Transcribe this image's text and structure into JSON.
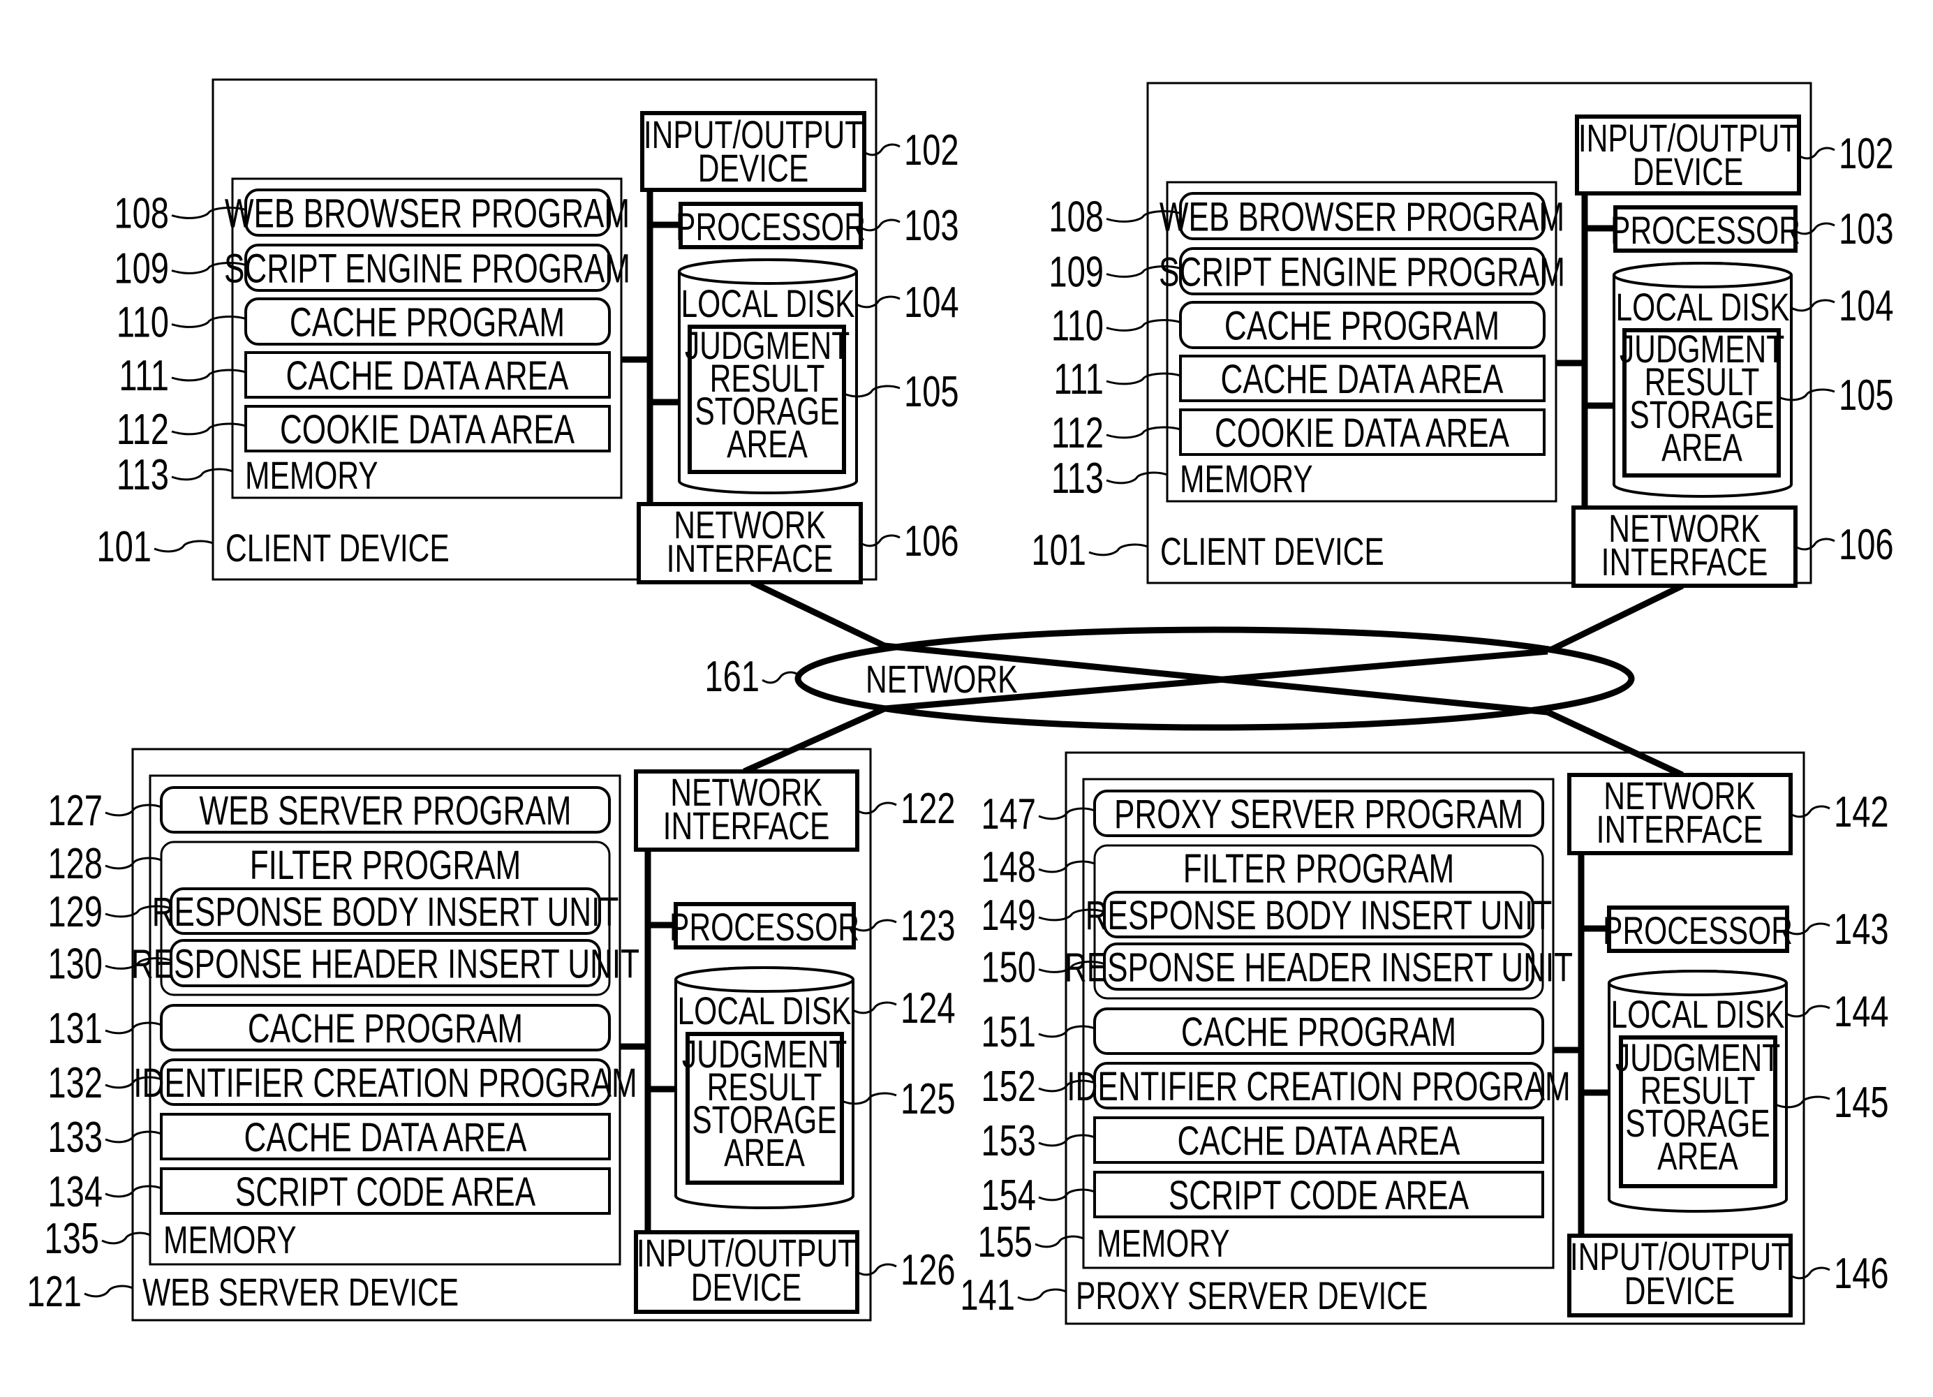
{
  "figure": {
    "network": {
      "ref": "161",
      "label": "NETWORK"
    },
    "client_devices": [
      {
        "ref": "101",
        "label": "CLIENT DEVICE",
        "memory": {
          "ref": "113",
          "label": "MEMORY",
          "items": [
            {
              "ref": "108",
              "label": "WEB BROWSER PROGRAM",
              "shape": "rounded"
            },
            {
              "ref": "109",
              "label": "SCRIPT ENGINE PROGRAM",
              "shape": "rounded"
            },
            {
              "ref": "110",
              "label": "CACHE PROGRAM",
              "shape": "rounded"
            },
            {
              "ref": "111",
              "label": "CACHE DATA AREA",
              "shape": "square"
            },
            {
              "ref": "112",
              "label": "COOKIE DATA AREA",
              "shape": "square"
            }
          ]
        },
        "io_device": {
          "ref": "102",
          "lines": [
            "INPUT/OUTPUT",
            "DEVICE"
          ]
        },
        "processor": {
          "ref": "103",
          "label": "PROCESSOR"
        },
        "local_disk": {
          "ref": "104",
          "label": "LOCAL DISK",
          "storage": {
            "ref": "105",
            "lines": [
              "JUDGMENT",
              "RESULT",
              "STORAGE",
              "AREA"
            ]
          }
        },
        "network_interface": {
          "ref": "106",
          "lines": [
            "NETWORK",
            "INTERFACE"
          ]
        }
      },
      {
        "ref": "101",
        "label": "CLIENT DEVICE",
        "memory": {
          "ref": "113",
          "label": "MEMORY",
          "items": [
            {
              "ref": "108",
              "label": "WEB BROWSER PROGRAM",
              "shape": "rounded"
            },
            {
              "ref": "109",
              "label": "SCRIPT ENGINE PROGRAM",
              "shape": "rounded"
            },
            {
              "ref": "110",
              "label": "CACHE PROGRAM",
              "shape": "rounded"
            },
            {
              "ref": "111",
              "label": "CACHE DATA AREA",
              "shape": "square"
            },
            {
              "ref": "112",
              "label": "COOKIE DATA AREA",
              "shape": "square"
            }
          ]
        },
        "io_device": {
          "ref": "102",
          "lines": [
            "INPUT/OUTPUT",
            "DEVICE"
          ]
        },
        "processor": {
          "ref": "103",
          "label": "PROCESSOR"
        },
        "local_disk": {
          "ref": "104",
          "label": "LOCAL DISK",
          "storage": {
            "ref": "105",
            "lines": [
              "JUDGMENT",
              "RESULT",
              "STORAGE",
              "AREA"
            ]
          }
        },
        "network_interface": {
          "ref": "106",
          "lines": [
            "NETWORK",
            "INTERFACE"
          ]
        }
      }
    ],
    "server_devices": [
      {
        "ref": "121",
        "label": "WEB SERVER DEVICE",
        "memory": {
          "ref": "135",
          "label": "MEMORY",
          "main_program": {
            "ref": "127",
            "label": "WEB SERVER PROGRAM"
          },
          "filter": {
            "ref": "128",
            "label": "FILTER PROGRAM",
            "units": [
              {
                "ref": "129",
                "label": "RESPONSE BODY INSERT UNIT"
              },
              {
                "ref": "130",
                "label": "RESPONSE HEADER INSERT UNIT"
              }
            ]
          },
          "items": [
            {
              "ref": "131",
              "label": "CACHE PROGRAM",
              "shape": "rounded"
            },
            {
              "ref": "132",
              "label": "IDENTIFIER CREATION PROGRAM",
              "shape": "rounded"
            },
            {
              "ref": "133",
              "label": "CACHE DATA AREA",
              "shape": "square"
            },
            {
              "ref": "134",
              "label": "SCRIPT CODE AREA",
              "shape": "square"
            }
          ]
        },
        "network_interface": {
          "ref": "122",
          "lines": [
            "NETWORK",
            "INTERFACE"
          ]
        },
        "processor": {
          "ref": "123",
          "label": "PROCESSOR"
        },
        "local_disk": {
          "ref": "124",
          "label": "LOCAL DISK",
          "storage": {
            "ref": "125",
            "lines": [
              "JUDGMENT",
              "RESULT",
              "STORAGE",
              "AREA"
            ]
          }
        },
        "io_device": {
          "ref": "126",
          "lines": [
            "INPUT/OUTPUT",
            "DEVICE"
          ]
        }
      },
      {
        "ref": "141",
        "label": "PROXY SERVER DEVICE",
        "memory": {
          "ref": "155",
          "label": "MEMORY",
          "main_program": {
            "ref": "147",
            "label": "PROXY SERVER PROGRAM"
          },
          "filter": {
            "ref": "148",
            "label": "FILTER PROGRAM",
            "units": [
              {
                "ref": "149",
                "label": "RESPONSE BODY INSERT UNIT"
              },
              {
                "ref": "150",
                "label": "RESPONSE HEADER INSERT UNIT"
              }
            ]
          },
          "items": [
            {
              "ref": "151",
              "label": "CACHE PROGRAM",
              "shape": "rounded"
            },
            {
              "ref": "152",
              "label": "IDENTIFIER CREATION PROGRAM",
              "shape": "rounded"
            },
            {
              "ref": "153",
              "label": "CACHE DATA AREA",
              "shape": "square"
            },
            {
              "ref": "154",
              "label": "SCRIPT CODE AREA",
              "shape": "square"
            }
          ]
        },
        "network_interface": {
          "ref": "142",
          "lines": [
            "NETWORK",
            "INTERFACE"
          ]
        },
        "processor": {
          "ref": "143",
          "label": "PROCESSOR"
        },
        "local_disk": {
          "ref": "144",
          "label": "LOCAL DISK",
          "storage": {
            "ref": "145",
            "lines": [
              "JUDGMENT",
              "RESULT",
              "STORAGE",
              "AREA"
            ]
          }
        },
        "io_device": {
          "ref": "146",
          "lines": [
            "INPUT/OUTPUT",
            "DEVICE"
          ]
        }
      }
    ]
  }
}
